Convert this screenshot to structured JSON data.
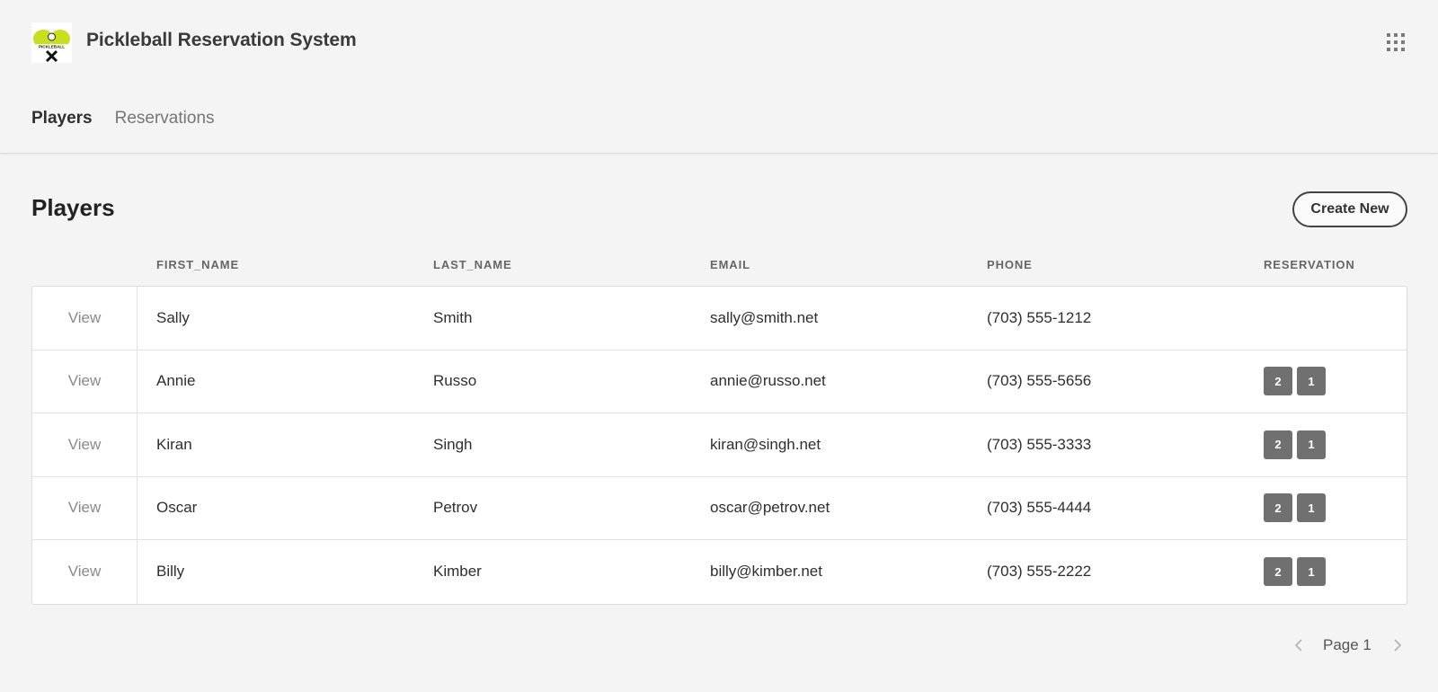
{
  "app": {
    "title": "Pickleball Reservation System",
    "logo_text": "PICKLEBALL"
  },
  "nav": {
    "tabs": [
      {
        "label": "Players",
        "active": true
      },
      {
        "label": "Reservations",
        "active": false
      }
    ]
  },
  "page": {
    "title": "Players",
    "create_button": "Create New"
  },
  "table": {
    "columns": [
      "FIRST_NAME",
      "LAST_NAME",
      "EMAIL",
      "PHONE",
      "RESERVATION"
    ],
    "view_label": "View",
    "rows": [
      {
        "first_name": "Sally",
        "last_name": "Smith",
        "email": "sally@smith.net",
        "phone": "(703) 555-1212",
        "reservations": []
      },
      {
        "first_name": "Annie",
        "last_name": "Russo",
        "email": "annie@russo.net",
        "phone": "(703) 555-5656",
        "reservations": [
          "2",
          "1"
        ]
      },
      {
        "first_name": "Kiran",
        "last_name": "Singh",
        "email": "kiran@singh.net",
        "phone": "(703) 555-3333",
        "reservations": [
          "2",
          "1"
        ]
      },
      {
        "first_name": "Oscar",
        "last_name": "Petrov",
        "email": "oscar@petrov.net",
        "phone": "(703) 555-4444",
        "reservations": [
          "2",
          "1"
        ]
      },
      {
        "first_name": "Billy",
        "last_name": "Kimber",
        "email": "billy@kimber.net",
        "phone": "(703) 555-2222",
        "reservations": [
          "2",
          "1"
        ]
      }
    ]
  },
  "pagination": {
    "label": "Page 1"
  },
  "colors": {
    "background": "#f4f4f4",
    "badge": "#707070",
    "logo_paddle": "#c8e01c"
  }
}
